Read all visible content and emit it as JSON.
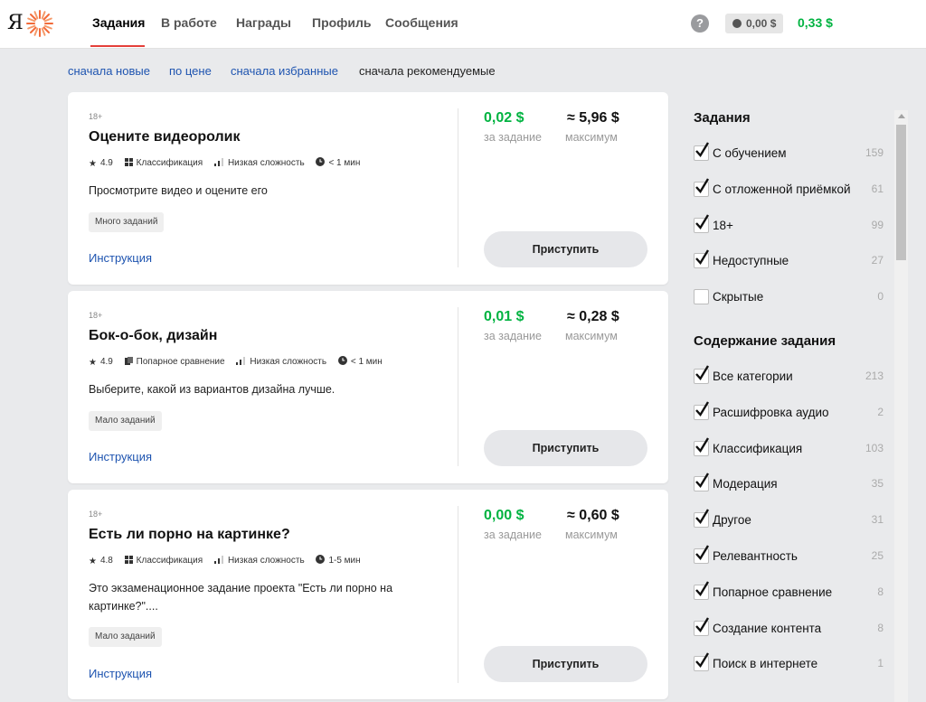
{
  "header": {
    "logo_letter": "Я",
    "nav": [
      "Задания",
      "В работе",
      "Награды",
      "Профиль",
      "Сообщения"
    ],
    "active_tab": "Задания",
    "help": "?",
    "pending_balance": "0,00 $",
    "balance": "0,33 $"
  },
  "sort": {
    "options": [
      "сначала новые",
      "по цене",
      "сначала избранные",
      "сначала рекомендуемые"
    ],
    "current": "сначала рекомендуемые"
  },
  "tasks": [
    {
      "age": "18+",
      "title": "Оцените видеоролик",
      "rating": "4.9",
      "type": "Классификация",
      "difficulty": "Низкая сложность",
      "duration": "< 1 мин",
      "description": "Просмотрите видео и оцените его",
      "volume": "Много заданий",
      "instruction": "Инструкция",
      "price": "0,02",
      "price_label": "за задание",
      "max": "≈ 5,96",
      "max_label": "максимум",
      "button": "Приступить"
    },
    {
      "age": "18+",
      "title": "Бок-о-бок, дизайн",
      "rating": "4.9",
      "type": "Попарное сравнение",
      "difficulty": "Низкая сложность",
      "duration": "< 1 мин",
      "description": "Выберите, какой из вариантов дизайна лучше.",
      "volume": "Мало заданий",
      "instruction": "Инструкция",
      "price": "0,01",
      "price_label": "за задание",
      "max": "≈ 0,28",
      "max_label": "максимум",
      "button": "Приступить"
    },
    {
      "age": "18+",
      "title": "Есть ли порно на картинке?",
      "rating": "4.8",
      "type": "Классификация",
      "difficulty": "Низкая сложность",
      "duration": "1-5 мин",
      "description": "Это экзаменационное задание проекта \"Есть ли порно на картинке?\"....",
      "volume": "Мало заданий",
      "instruction": "Инструкция",
      "price": "0,00",
      "price_label": "за задание",
      "max": "≈ 0,60",
      "max_label": "максимум",
      "button": "Приступить"
    }
  ],
  "currency_symbol": "$",
  "sidebar": {
    "tasks_heading": "Задания",
    "task_filters": [
      {
        "label": "С обучением",
        "count": "159",
        "checked": true
      },
      {
        "label": "С отложенной приёмкой",
        "count": "61",
        "checked": true
      },
      {
        "label": "18+",
        "count": "99",
        "checked": true
      },
      {
        "label": "Недоступные",
        "count": "27",
        "checked": true
      },
      {
        "label": "Скрытые",
        "count": "0",
        "checked": false
      }
    ],
    "content_heading": "Содержание задания",
    "content_filters": [
      {
        "label": "Все категории",
        "count": "213",
        "checked": true
      },
      {
        "label": "Расшифровка аудио",
        "count": "2",
        "checked": true
      },
      {
        "label": "Классификация",
        "count": "103",
        "checked": true
      },
      {
        "label": "Модерация",
        "count": "35",
        "checked": true
      },
      {
        "label": "Другое",
        "count": "31",
        "checked": true
      },
      {
        "label": "Релевантность",
        "count": "25",
        "checked": true
      },
      {
        "label": "Попарное сравнение",
        "count": "8",
        "checked": true
      },
      {
        "label": "Создание контента",
        "count": "8",
        "checked": true
      },
      {
        "label": "Поиск в интернете",
        "count": "1",
        "checked": true
      }
    ]
  },
  "colors": {
    "accent_green": "#00b341",
    "link_blue": "#1e54b0",
    "active_underline": "#e4403a"
  }
}
